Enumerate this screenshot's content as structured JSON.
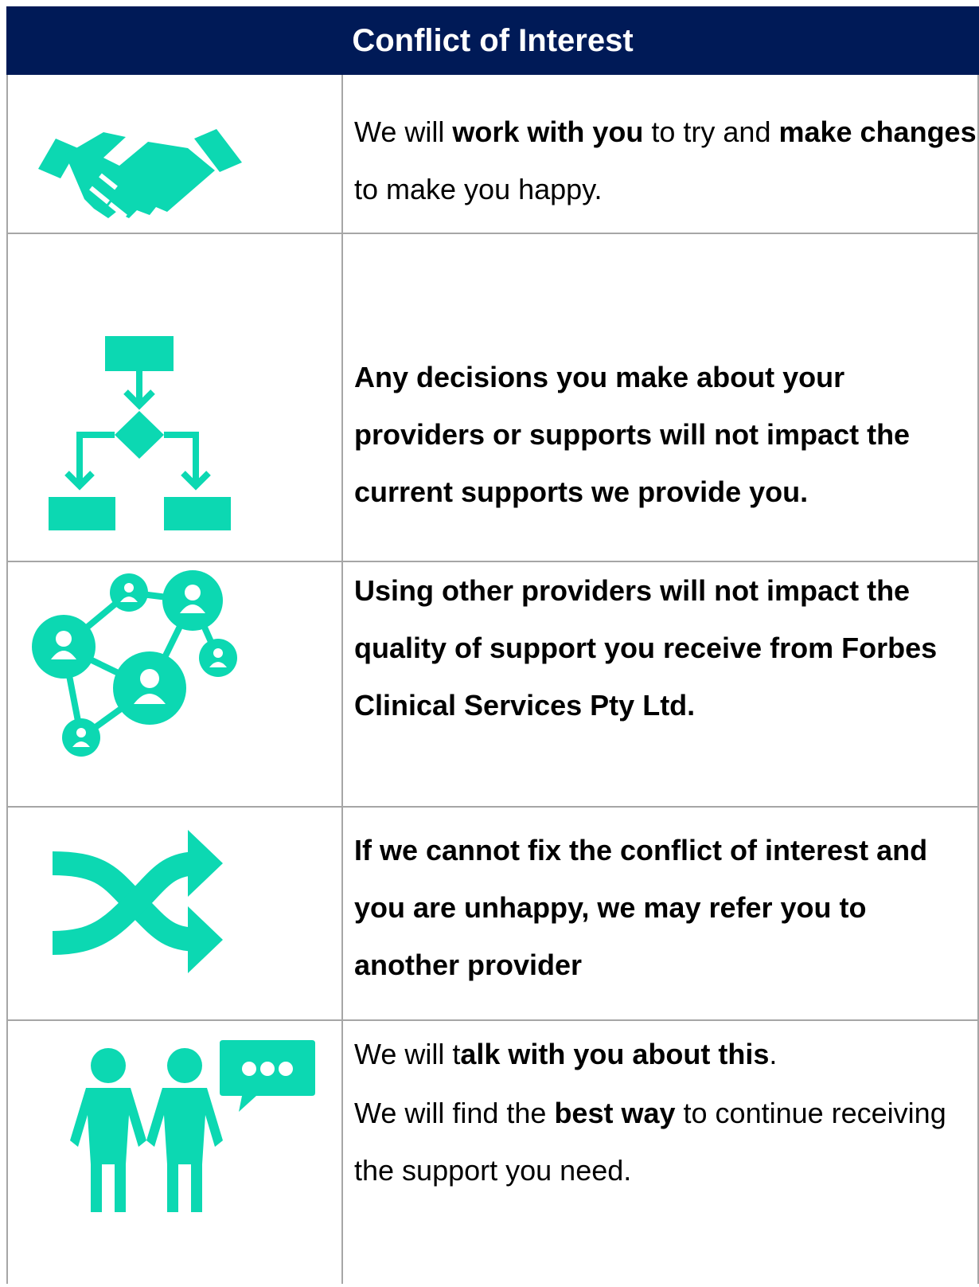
{
  "title": "Conflict of Interest",
  "colors": {
    "header_bg": "#001a57",
    "header_text": "#ffffff",
    "icon": "#0cd8b2",
    "border": "#a6a6a6"
  },
  "rows": [
    {
      "icon": "handshake-icon",
      "segments": [
        {
          "text": "We will ",
          "bold": false
        },
        {
          "text": "work with you",
          "bold": true
        },
        {
          "text": " to try and ",
          "bold": false
        },
        {
          "text": "make changes",
          "bold": true
        },
        {
          "text": " to make you happy.",
          "bold": false
        }
      ]
    },
    {
      "icon": "flowchart-icon",
      "segments": [
        {
          "text": "Any decisions you make about your providers or supports will not impact the current supports we provide you.",
          "bold": true
        }
      ]
    },
    {
      "icon": "people-network-icon",
      "segments": [
        {
          "text": "Using other providers will not impact the quality of support you receive from Forbes Clinical Services Pty Ltd.",
          "bold": true
        }
      ]
    },
    {
      "icon": "shuffle-arrows-icon",
      "segments": [
        {
          "text": "If we cannot fix the conflict of interest and you are unhappy, we may refer you to another provider",
          "bold": true
        }
      ]
    },
    {
      "icon": "two-people-talking-icon",
      "para1": [
        {
          "text": "We will t",
          "bold": false
        },
        {
          "text": "alk with you about this",
          "bold": true
        },
        {
          "text": ".",
          "bold": false
        }
      ],
      "para2": [
        {
          "text": "We will find the ",
          "bold": false
        },
        {
          "text": "best way",
          "bold": true
        },
        {
          "text": " to continue receiving the support you need.",
          "bold": false
        }
      ]
    }
  ]
}
